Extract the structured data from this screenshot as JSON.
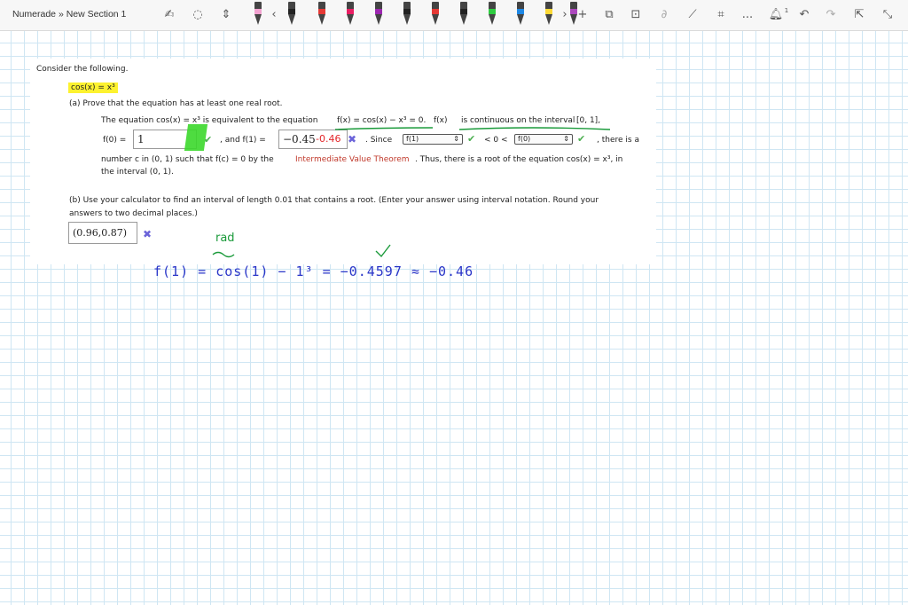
{
  "window": {
    "breadcrumb": "Numerade » New Section 1"
  },
  "toolbar": {
    "more_label": "...",
    "notification_count": "1",
    "pens": [
      {
        "color": "#f2a2d0"
      },
      {
        "color": "#222222"
      },
      {
        "color": "#e53935"
      },
      {
        "color": "#e91e63"
      },
      {
        "color": "#9c27b0"
      },
      {
        "color": "#222222"
      },
      {
        "color": "#e53935"
      },
      {
        "color": "#222222"
      },
      {
        "color": "#2ecc40"
      },
      {
        "color": "#1e88e5"
      },
      {
        "color": "#fdd835"
      },
      {
        "color": "#ab47bc"
      }
    ]
  },
  "problem": {
    "intro": "Consider the following.",
    "equation": "cos(x) = x³",
    "part_a_prompt": "(a) Prove that the equation has at least one real root.",
    "line1_a": "The equation  cos(x) = x³  is equivalent to the equation ",
    "line1_b": "f(x) = cos(x) − x³ = 0.",
    "line1_c": "  f(x)  ",
    "line1_d": "is continuous on the interval",
    "line1_e": "  [0, 1],",
    "f0_label": "f(0) =",
    "f0_value": "1",
    "and_f1_label": ", and  f(1) =",
    "f1_value": "−0.45",
    "since_label": ".  Since",
    "select1_value": "f(1)",
    "lt_label": "< 0 <",
    "select2_value": "f(0)",
    "there_is_label": ",  there is a",
    "line3": "number c in  (0, 1)  such that  f(c) = 0  by the ",
    "ivt_link": "Intermediate Value Theorem",
    "line3_end": ".  Thus, there is a root of the equation  cos(x) = x³,  in",
    "line4": "the interval  (0, 1).",
    "part_b_prompt_1": "(b) Use your calculator to find an interval of length 0.01 that contains a root. (Enter your answer using interval notation. Round your",
    "part_b_prompt_2": "answers to two decimal places.)",
    "part_b_answer": "(0.96,0.87)"
  },
  "handwriting": {
    "rad_note": "rad",
    "f1_correction": "-0.46",
    "work_line": "f(1) = cos(1) − 1³ = −0.4597 ≈ −0.46"
  },
  "colors": {
    "highlight": "#fdf22f",
    "check": "#4caf50",
    "cross": "#6b63d9",
    "ink_blue": "#2a36c8",
    "ink_green": "#1a9a3a",
    "ink_red": "#e3262a",
    "link": "#c0392b"
  }
}
